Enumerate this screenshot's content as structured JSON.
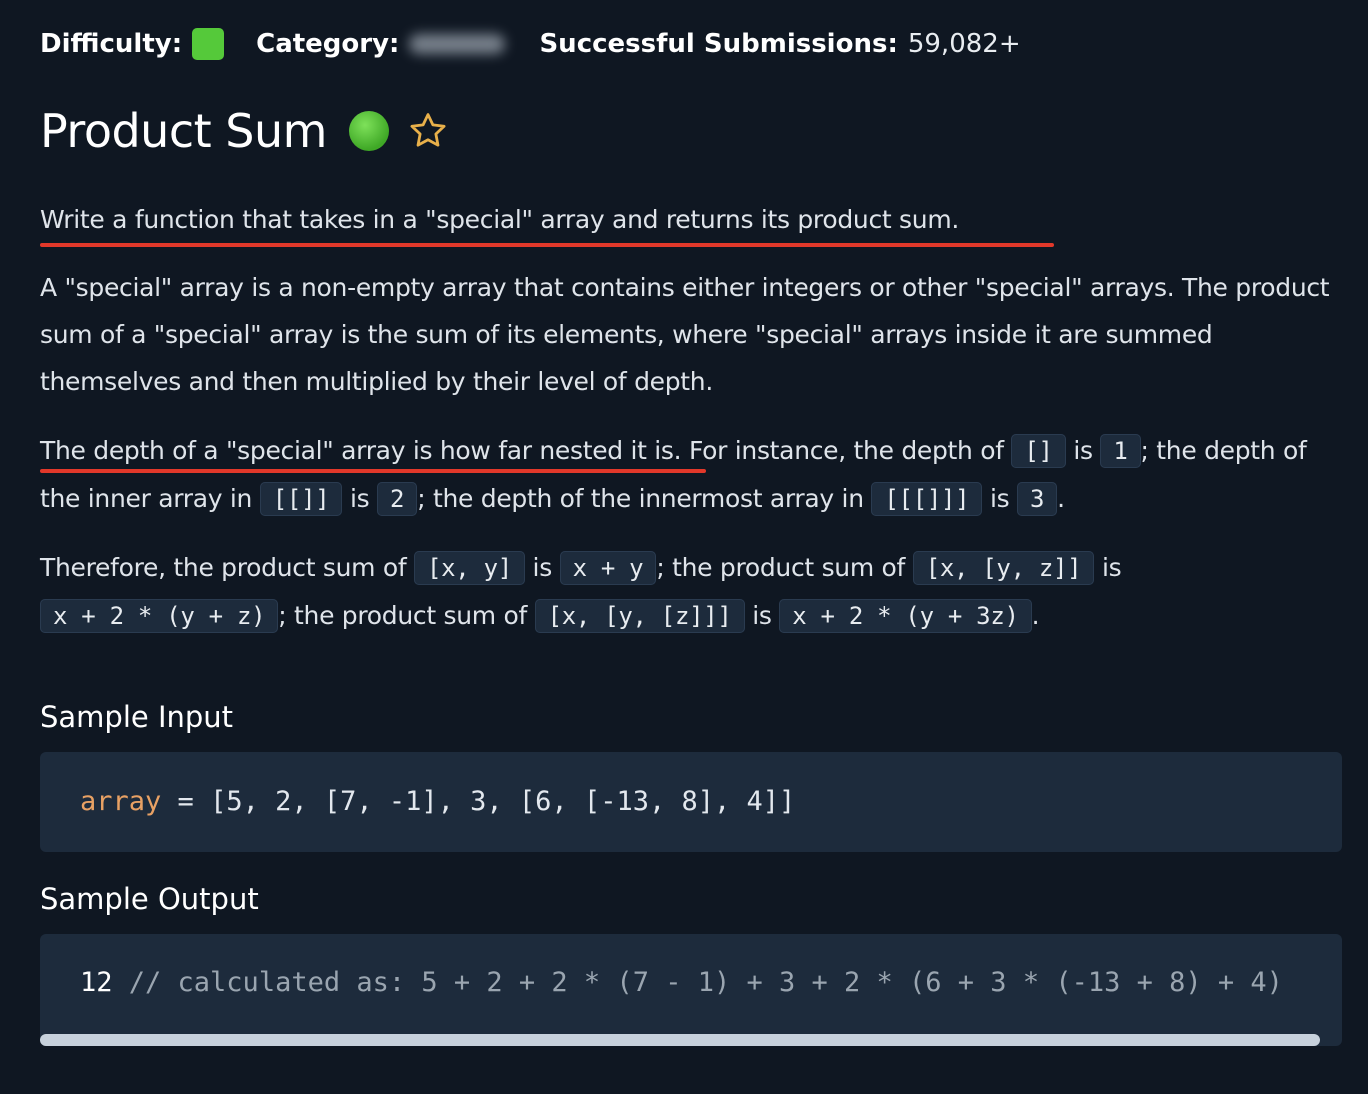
{
  "meta": {
    "difficulty_label": "Difficulty:",
    "category_label": "Category:",
    "submissions_label": "Successful Submissions:",
    "submissions_value": "59,082+",
    "colors": {
      "difficulty": "#55c93a",
      "status": "#4fbf33",
      "highlight": "#e2382a",
      "keyword": "#e8a164"
    }
  },
  "title": "Product Sum",
  "icons": {
    "status": "completed-status-icon",
    "favorite": "star-icon"
  },
  "p1": "Write a function that takes in a \"special\" array and returns its product sum.",
  "p2": "A \"special\" array is a non-empty array that contains either integers or other \"special\" arrays. The product sum of a \"special\" array is the sum of its elements, where \"special\" arrays inside it are summed themselves and then multiplied by their level of depth.",
  "p3": {
    "t1": "The depth of a \"special\" array is how far nested it is. For instance, the depth of ",
    "c1": "[]",
    "t2": " is ",
    "c2": "1",
    "t3": "; the depth of the inner array in ",
    "c3": "[[]]",
    "t4": " is ",
    "c4": "2",
    "t5": "; the depth of the innermost array in ",
    "c5": "[[[]]]",
    "t6": " is ",
    "c6": "3",
    "t7": "."
  },
  "p4": {
    "t1": "Therefore, the product sum of ",
    "c1": "[x, y]",
    "t2": " is ",
    "c2": "x + y",
    "t3": "; the product sum of ",
    "c3": "[x, [y, z]]",
    "t4": " is ",
    "c4": "x + 2 * (y + z)",
    "t5": "; the product sum of ",
    "c5": "[x, [y, [z]]]",
    "t6": " is ",
    "c6": "x + 2 * (y + 3z)",
    "t7": "."
  },
  "sample_input": {
    "heading": "Sample Input",
    "var": "array",
    "eq": " = ",
    "value": "[5, 2, [7, -1], 3, [6, [-13, 8], 4]]"
  },
  "sample_output": {
    "heading": "Sample Output",
    "result": "12",
    "comment": " // calculated as: 5 + 2 + 2 * (7 - 1) + 3 + 2 * (6 + 3 * (-13 + 8) + 4)"
  }
}
